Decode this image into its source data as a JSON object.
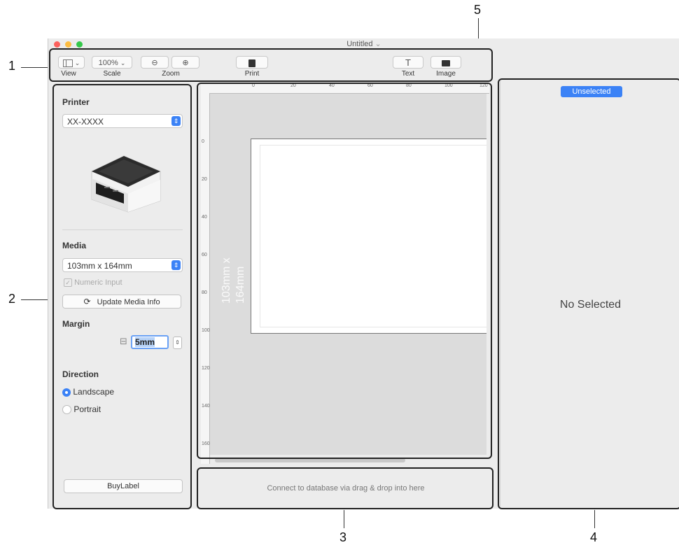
{
  "window": {
    "title": "Untitled"
  },
  "toolbar": {
    "view_label": "View",
    "scale_value": "100%",
    "scale_label": "Scale",
    "zoom_label": "Zoom",
    "print_label": "Print",
    "text_label": "Text",
    "image_label": "Image",
    "text_icon_glyph": "T"
  },
  "left_panel": {
    "printer_title": "Printer",
    "printer_value": "XX-XXXX",
    "media_title": "Media",
    "media_value": "103mm x 164mm",
    "numeric_input_label": "Numeric Input",
    "update_media_label": "Update Media Info",
    "margin_title": "Margin",
    "margin_value": "5mm",
    "direction_title": "Direction",
    "landscape_label": "Landscape",
    "portrait_label": "Portrait",
    "buylabel_label": "BuyLabel"
  },
  "canvas": {
    "size_line1": "103mm",
    "size_line2": "x 164mm",
    "ruler_top": [
      "0",
      "20",
      "40",
      "60",
      "80",
      "100",
      "120"
    ],
    "ruler_left": [
      "0",
      "20",
      "40",
      "60",
      "80",
      "100",
      "120",
      "140",
      "160"
    ]
  },
  "database": {
    "hint": "Connect to database via drag & drop into here"
  },
  "inspector": {
    "tab_label": "Unselected",
    "empty_text": "No Selected"
  },
  "callouts": [
    "1",
    "2",
    "3",
    "4",
    "5"
  ],
  "colors": {
    "accent": "#3b82f6",
    "traffic_red": "#fc615d",
    "traffic_yellow": "#fdbc40",
    "traffic_green": "#34c84a"
  }
}
